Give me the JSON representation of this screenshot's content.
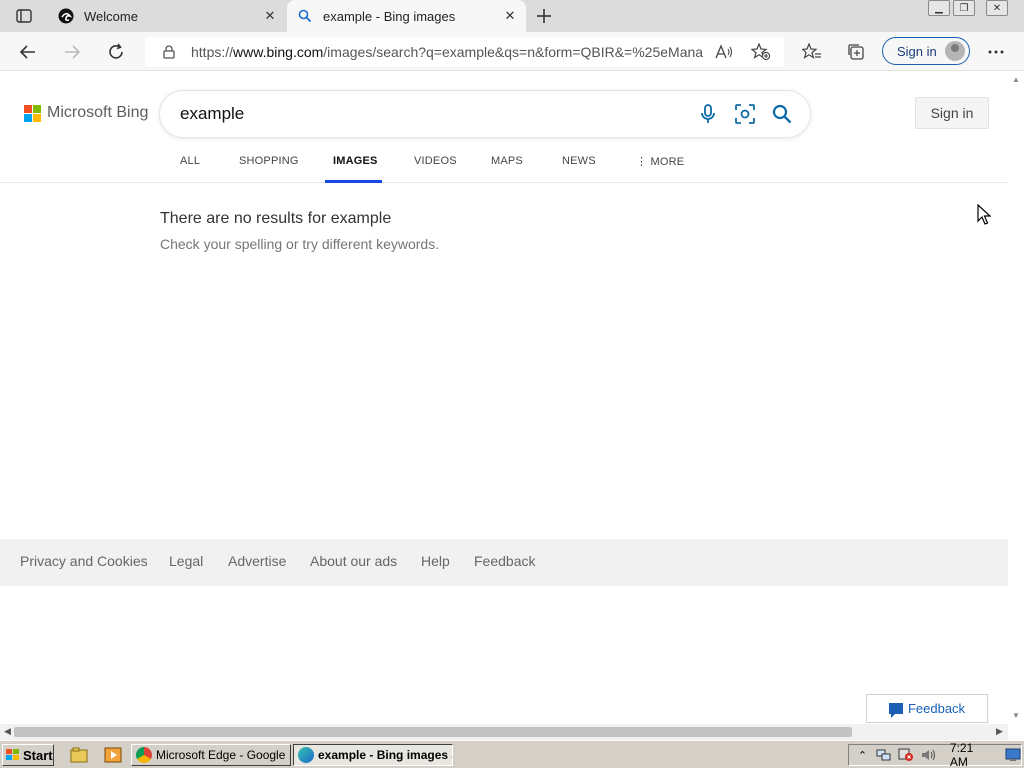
{
  "browser": {
    "tabs": [
      {
        "title": "Welcome",
        "active": false
      },
      {
        "title": "example - Bing images",
        "active": true
      }
    ],
    "url_prefix": "https://",
    "url_host": "www.bing.com",
    "url_path": "/images/search?q=example&qs=n&form=QBIR&=%25eMana...",
    "signin_label": "Sign in"
  },
  "bing": {
    "logo_text": "Microsoft Bing",
    "logo_colors": [
      "#f25022",
      "#7fba00",
      "#00a4ef",
      "#ffb900"
    ],
    "query": "example",
    "signin_button": "Sign in",
    "nav": [
      {
        "label": "ALL"
      },
      {
        "label": "SHOPPING"
      },
      {
        "label": "IMAGES",
        "active": true
      },
      {
        "label": "VIDEOS"
      },
      {
        "label": "MAPS"
      },
      {
        "label": "NEWS"
      },
      {
        "label": "MORE"
      }
    ],
    "no_results_title": "There are no results for example",
    "no_results_sub": "Check your spelling or try different keywords.",
    "footer_links": [
      "Privacy and Cookies",
      "Legal",
      "Advertise",
      "About our ads",
      "Help",
      "Feedback"
    ],
    "feedback_button": "Feedback",
    "accent_color": "#174ae4"
  },
  "taskbar": {
    "start_label": "Start",
    "tasks": [
      {
        "label": "Microsoft Edge - Google ...",
        "active": false
      },
      {
        "label": "example - Bing images a...",
        "active": true
      }
    ],
    "clock": "7:21 AM"
  }
}
